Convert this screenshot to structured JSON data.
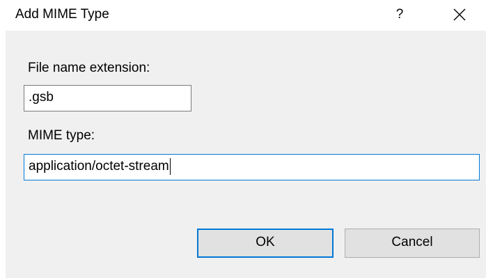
{
  "window": {
    "title": "Add MIME Type",
    "help_label": "?",
    "close_icon": "close-icon"
  },
  "form": {
    "extension_label": "File name extension:",
    "extension_value": ".gsb",
    "mime_label": "MIME type:",
    "mime_value": "application/octet-stream"
  },
  "buttons": {
    "ok_label": "OK",
    "cancel_label": "Cancel"
  },
  "colors": {
    "accent": "#0078d7",
    "dialog_background": "#f0f0f0",
    "button_background": "#e1e1e1"
  }
}
